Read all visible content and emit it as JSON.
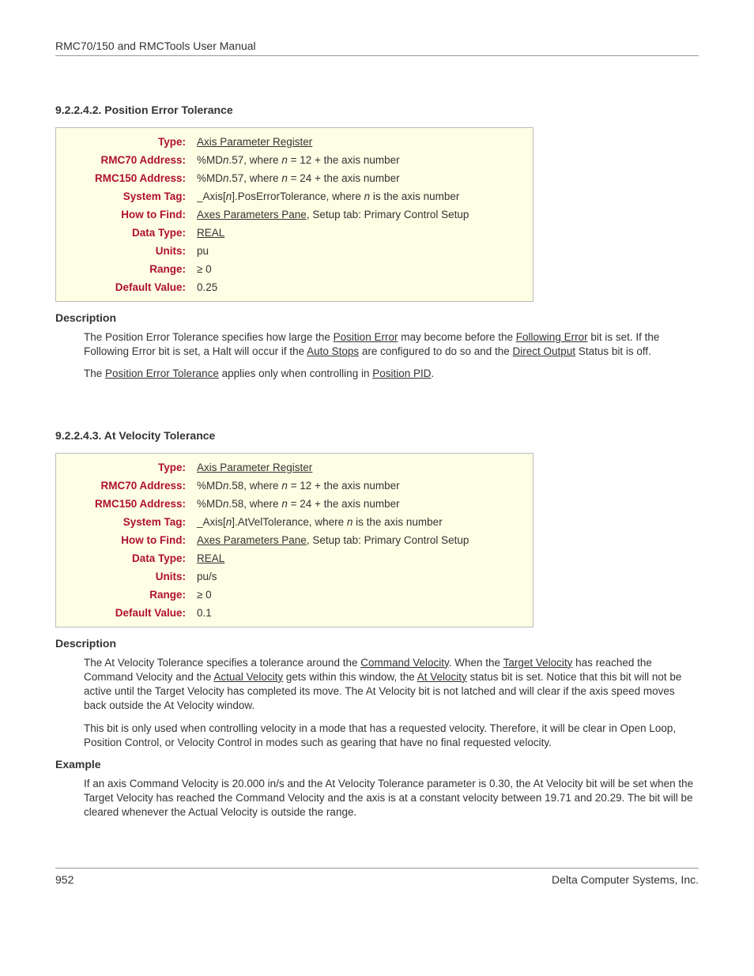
{
  "header": "RMC70/150 and RMCTools User Manual",
  "footer_left": "952",
  "footer_right": "Delta Computer Systems, Inc.",
  "labels": {
    "type": "Type:",
    "rmc70": "RMC70 Address:",
    "rmc150": "RMC150 Address:",
    "systag": "System Tag:",
    "howto": "How to Find:",
    "dtype": "Data Type:",
    "units": "Units:",
    "range": "Range:",
    "default": "Default Value:"
  },
  "sec1": {
    "title": "9.2.2.4.2. Position Error Tolerance",
    "type": "Axis Parameter Register",
    "rmc70_pre": "%MD",
    "rmc70_mid": ".57, where ",
    "rmc70_post": " = 12 + the axis number",
    "rmc150_pre": "%MD",
    "rmc150_mid": ".57, where ",
    "rmc150_post": " = 24 + the axis number",
    "systag_pre": "_Axis[",
    "systag_mid": "].PosErrorTolerance, where ",
    "systag_post": " is the axis number",
    "howto_link": "Axes Parameters Pane",
    "howto_rest": ", Setup tab: Primary Control Setup",
    "dtype": "REAL",
    "units": "pu",
    "range": "≥ 0",
    "default": "0.25",
    "desc_head": "Description",
    "p1a": "The Position Error Tolerance specifies how large the ",
    "p1_link1": "Position Error",
    "p1b": " may become before the ",
    "p1_link2": "Following Error",
    "p1c": " bit is set. If the Following Error bit is set, a Halt will occur if the ",
    "p1_link3": "Auto Stops",
    "p1d": " are configured to do so and the ",
    "p1_link4": "Direct Output",
    "p1e": " Status bit is off.",
    "p2a": "The ",
    "p2_link1": "Position Error Tolerance",
    "p2b": " applies only when controlling in ",
    "p2_link2": "Position PID",
    "p2c": "."
  },
  "sec2": {
    "title": "9.2.2.4.3. At Velocity Tolerance",
    "type": "Axis Parameter Register",
    "rmc70_pre": "%MD",
    "rmc70_mid": ".58, where ",
    "rmc70_post": " = 12 + the axis number",
    "rmc150_pre": "%MD",
    "rmc150_mid": ".58, where ",
    "rmc150_post": " = 24 + the axis number",
    "systag_pre": "_Axis[",
    "systag_mid": "].AtVelTolerance, where ",
    "systag_post": " is the axis number",
    "howto_link": "Axes Parameters Pane",
    "howto_rest": ", Setup tab: Primary Control Setup",
    "dtype": "REAL",
    "units": "pu/s",
    "range": "≥ 0",
    "default": "0.1",
    "desc_head": "Description",
    "p1a": "The At Velocity Tolerance specifies a tolerance around the ",
    "p1_link1": "Command Velocity",
    "p1b": ". When the ",
    "p1_link2": "Target Velocity",
    "p1c": " has reached the Command Velocity and the ",
    "p1_link3": "Actual Velocity",
    "p1d": " gets within this window, the ",
    "p1_link4": "At Velocity",
    "p1e": " status bit is set. Notice that this bit will not be active until the Target Velocity has completed its move. The At Velocity bit is not latched and will clear if the axis speed moves back outside the At Velocity window.",
    "p2": "This bit is only used when controlling velocity in a mode that has a requested velocity. Therefore, it will be clear in Open Loop, Position Control, or Velocity Control in modes such as gearing that have no final requested velocity.",
    "ex_head": "Example",
    "ex": "If an axis Command Velocity is 20.000 in/s and the At Velocity Tolerance parameter is 0.30, the At Velocity bit will be set when the Target Velocity has reached the Command Velocity and the axis is at a constant velocity between 19.71 and 20.29.  The bit will be cleared whenever the Actual Velocity is outside the range."
  },
  "n": "n"
}
